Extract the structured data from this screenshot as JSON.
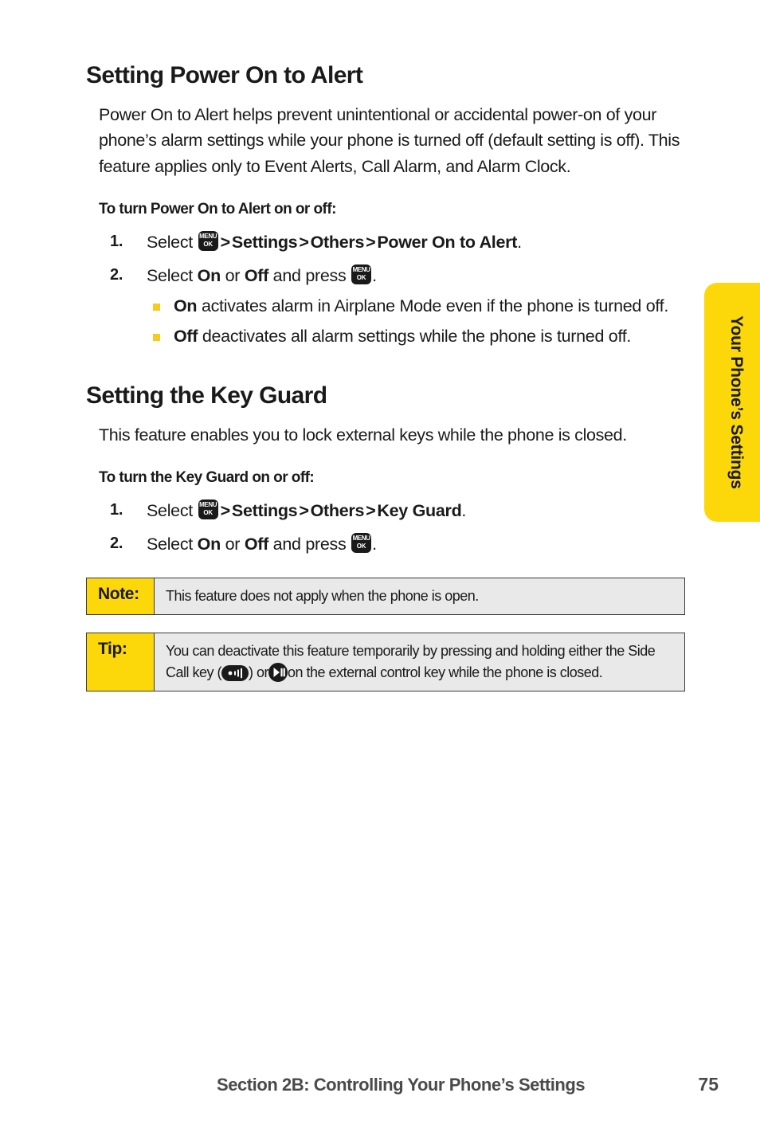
{
  "side_tab": {
    "label": "Your Phone’s Settings",
    "color": "#FCD80B"
  },
  "sections": [
    {
      "heading": "Setting Power On to Alert",
      "body": "Power On to Alert helps prevent unintentional or accidental power-on of your phone’s alarm settings while your phone is turned off (default setting is off). This feature applies only to Event Alerts, Call Alarm, and Alarm Clock.",
      "sub_heading": "To turn Power On to Alert on or off:",
      "steps": [
        {
          "num": "1.",
          "lead": "Select",
          "icon": "menu-ok-key-icon",
          "sep1": ">",
          "path1": "Settings",
          "sep2": ">",
          "path2": "Others",
          "sep3": ">",
          "path3": "Power On to Alert",
          "period": "."
        },
        {
          "num": "2.",
          "lead": "Select",
          "option_on": "On",
          "conj": "or",
          "option_off": "Off",
          "tail": "and press",
          "icon": "menu-ok-key-icon",
          "period": "."
        }
      ],
      "bullets": [
        {
          "term": "On",
          "text": "activates alarm in Airplane Mode even if the phone is turned off."
        },
        {
          "term": "Off",
          "text": "deactivates all alarm settings while the phone is turned off."
        }
      ]
    },
    {
      "heading": "Setting the Key Guard",
      "body": "This feature enables you to lock external keys while the phone is closed.",
      "sub_heading": "To turn the Key Guard on or off:",
      "steps": [
        {
          "num": "1.",
          "lead": "Select",
          "icon": "menu-ok-key-icon",
          "sep1": ">",
          "path1": "Settings",
          "sep2": ">",
          "path2": "Others",
          "sep3": ">",
          "path3": "Key Guard",
          "period": "."
        },
        {
          "num": "2.",
          "lead": "Select",
          "option_on": "On",
          "conj": "or",
          "option_off": "Off",
          "tail": "and press",
          "icon": "menu-ok-key-icon",
          "period": "."
        }
      ]
    }
  ],
  "note": {
    "label": "Note:",
    "text": "This feature does not apply when the phone is open."
  },
  "tip": {
    "label": "Tip:",
    "text_part1": "You can deactivate this feature temporarily by pressing and holding either the Side Call key (",
    "icon1": "side-call-key-icon",
    "text_part2": ") or",
    "icon2": "play-pause-key-icon",
    "text_part3": "on the external control key while the phone is closed."
  },
  "key_icon": {
    "line1": "MENU",
    "line2": "OK"
  },
  "footer": {
    "section": "Section 2B: Controlling Your Phone’s Settings",
    "page": "75"
  }
}
